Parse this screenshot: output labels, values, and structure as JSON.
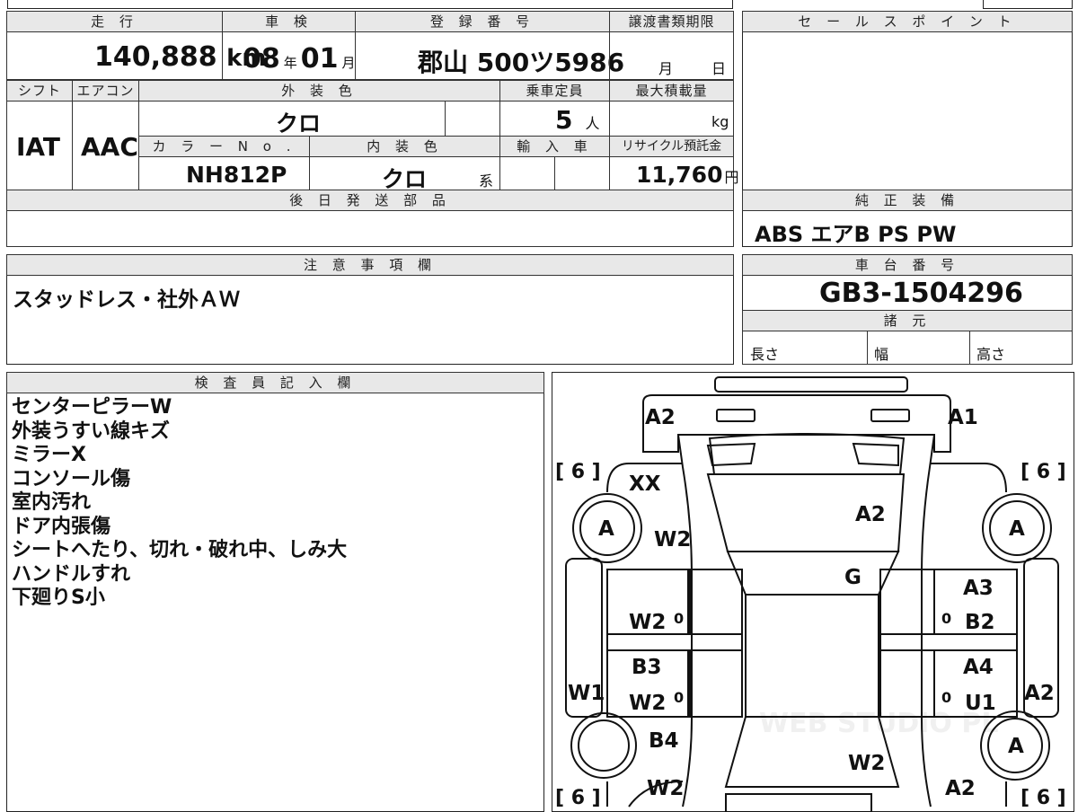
{
  "headers": {
    "mileage": "走 行",
    "inspection": "車 検",
    "registration": "登 録 番 号",
    "transfer_deadline": "譲渡書類期限",
    "sale_points": "セ ー ル ス ポ イ ン ト",
    "shift": "シフト",
    "aircon": "エアコン",
    "exterior_color": "外 装 色",
    "capacity": "乗車定員",
    "max_load": "最大積載量",
    "color_no": "カ ラ ー N o .",
    "interior_color": "内 装 色",
    "import": "輸 入 車",
    "recycle": "リサイクル預託金",
    "later_parts": "後 日 発 送 部 品",
    "equipment": "純 正 装 備",
    "notes": "注 意 事 項 欄",
    "chassis": "車 台 番 号",
    "specs": "諸 元",
    "inspector": "検 査 員 記 入 欄"
  },
  "mileage": {
    "value": "140,888",
    "unit": "km"
  },
  "inspection": {
    "year": "08",
    "year_unit": "年",
    "month": "01",
    "month_unit": "月"
  },
  "registration": {
    "plate": "郡山 500ツ5986"
  },
  "transfer_deadline": {
    "month_unit": "月",
    "day_unit": "日"
  },
  "shift": "IAT",
  "aircon": "AAC",
  "exterior_color": "クロ",
  "capacity": {
    "value": "5",
    "unit": "人"
  },
  "max_load": {
    "unit": "kg"
  },
  "color_no": "NH812P",
  "interior_color": {
    "value": "クロ",
    "suffix": "系"
  },
  "recycle": {
    "value": "11,760",
    "unit": "円"
  },
  "equipment": "ABS エアB PS PW",
  "notes": "スタッドレス・社外ＡＷ",
  "chassis": "GB3-1504296",
  "specs": {
    "length": "長さ",
    "width": "幅",
    "height": "高さ"
  },
  "inspector_notes": [
    "センターピラーW",
    "外装うすい線キズ",
    "ミラーX",
    "コンソール傷",
    "室内汚れ",
    "ドア内張傷",
    "シートへたり、切れ・破れ中、しみ大",
    "ハンドルすれ",
    "下廻りS小"
  ],
  "diagram": {
    "tire_marks": [
      "[ 6 ]",
      "[ 6 ]",
      "[ 6 ]",
      "[ 6 ]"
    ],
    "labels": [
      "A2",
      "A1",
      "XX",
      "A",
      "W2",
      "A2",
      "A",
      "G",
      "A3",
      "W2",
      "B2",
      "B3",
      "A4",
      "W1",
      "W2",
      "U1",
      "A2",
      "B4",
      "A",
      "W2",
      "W2",
      "A2"
    ],
    "zeros": [
      "0",
      "0",
      "0",
      "0"
    ],
    "watermark": "WEB STUDIO PL"
  }
}
